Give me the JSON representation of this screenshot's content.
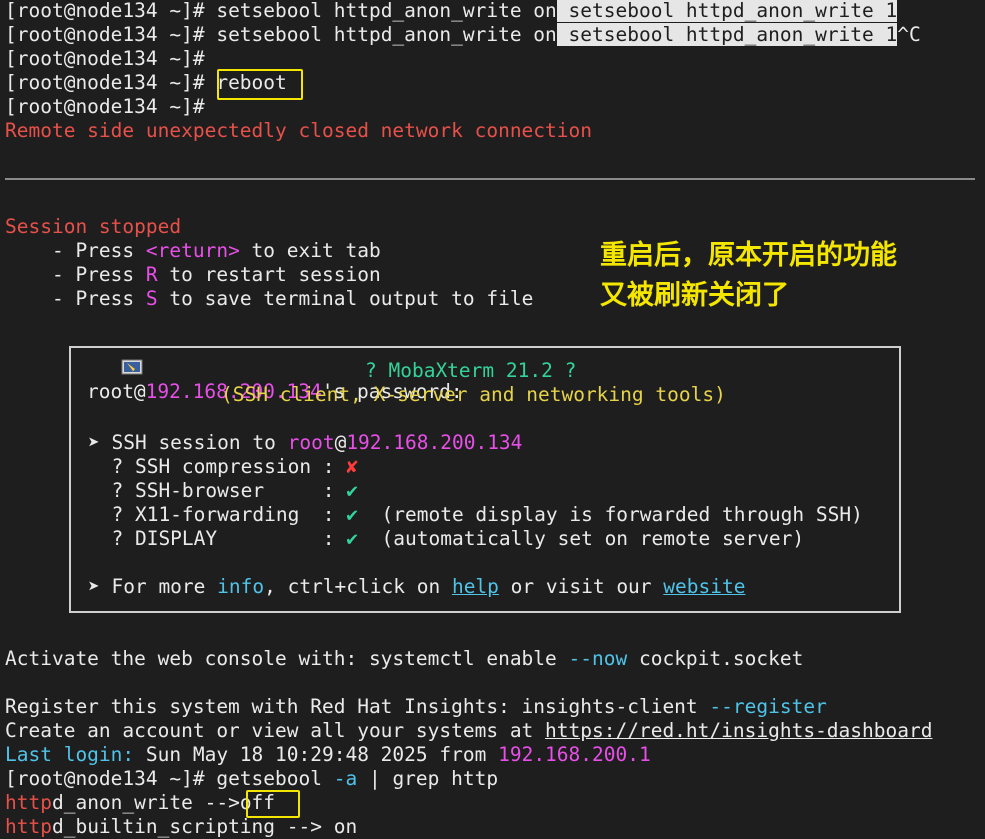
{
  "lines": {
    "l1_prompt": "[root@node134 ~]# ",
    "l1_cmd": "setsebool httpd_anon_write on",
    "l1_hl": " setsebool httpd_anon_write 1",
    "l2_prompt": "[root@node134 ~]# ",
    "l2_cmd": "setsebool httpd_anon_write on",
    "l2_hl": " setsebool httpd_anon_write 1",
    "l2_tail": "^C",
    "l3": "[root@node134 ~]#",
    "l4_prompt": "[root@node134 ~]# ",
    "l4_cmd": "reboot",
    "l5": "[root@node134 ~]#",
    "l6": "Remote side unexpectedly closed network connection",
    "session_stopped": "Session stopped",
    "press1_a": "    - Press ",
    "press1_key": "<return>",
    "press1_b": " to exit tab",
    "press2_a": "    - Press ",
    "press2_key": "R",
    "press2_b": " to restart session",
    "press3_a": "    - Press ",
    "press3_key": "S",
    "press3_b": " to save terminal output to file",
    "pw_user": "root@",
    "pw_ip": "192.168.200.134",
    "pw_tail": "'s password:"
  },
  "annotation": {
    "line1": "重启后，原本开启的功能",
    "line2": "又被刷新关闭了"
  },
  "banner": {
    "title": "? MobaXterm 21.2 ?",
    "subtitle": "(SSH client, X-server and networking tools)",
    "ssh_a": "➤ SSH session to ",
    "ssh_user": "root",
    "ssh_at": "@",
    "ssh_ip": "192.168.200.134",
    "comp_label": "  ? SSH compression : ",
    "comp_val": "✘",
    "browser_label": "  ? SSH-browser     : ",
    "browser_val": "✔",
    "x11_label": "  ? X11-forwarding  : ",
    "x11_val": "✔",
    "x11_note": "  (remote display is forwarded through SSH)",
    "disp_label": "  ? DISPLAY         : ",
    "disp_val": "✔",
    "disp_note": "  (automatically set on remote server)",
    "more_a": "➤ For more ",
    "more_info": "info",
    "more_b": ", ctrl+click on ",
    "more_help": "help",
    "more_c": " or visit our ",
    "more_site": "website"
  },
  "post": {
    "activate_a": "Activate the web console with: systemctl enable ",
    "activate_flag": "--now",
    "activate_b": " cockpit.socket",
    "register_a": "Register this system with Red Hat Insights: insights-client ",
    "register_flag": "--register",
    "account_a": "Create an account or view all your systems at ",
    "account_url": "https://red.ht/insights-dashboard",
    "login_label": "Last login:",
    "login_time": " Sun May 18 10:29:48 2025 from ",
    "login_ip": "192.168.200.1",
    "cmd_prompt": "[root@node134 ~]# ",
    "cmd_a": "getsebool ",
    "cmd_flag": "-a",
    "cmd_b": " | grep http",
    "r1_key": "http",
    "r1_rest": "d_anon_write -->",
    "r1_val": "off",
    "r2_key": "http",
    "r2_rest": "d_builtin_scripting --> on"
  }
}
